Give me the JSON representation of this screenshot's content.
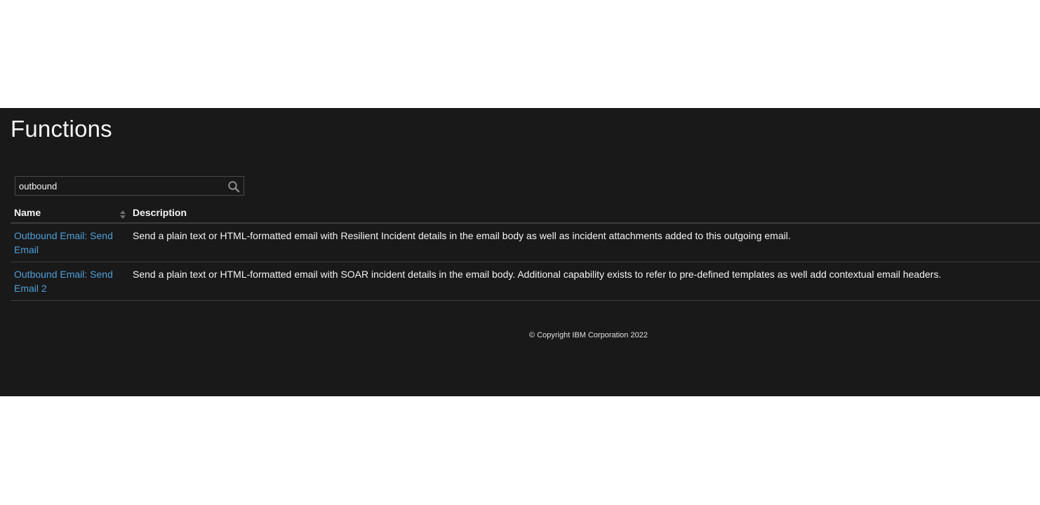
{
  "page": {
    "title": "Functions"
  },
  "search": {
    "value": "outbound",
    "icon": "search-icon"
  },
  "table": {
    "headers": {
      "name": "Name",
      "description": "Description"
    },
    "rows": [
      {
        "name": "Outbound Email: Send Email",
        "description": "Send a plain text or HTML-formatted email with Resilient Incident details in the email body as well as incident attachments added to this outgoing email."
      },
      {
        "name": "Outbound Email: Send Email 2",
        "description": "Send a plain text or HTML-formatted email with SOAR incident details in the email body. Additional capability exists to refer to pre-defined templates as well add contextual email headers."
      }
    ]
  },
  "footer": {
    "copyright": "© Copyright IBM Corporation 2022"
  },
  "colors": {
    "background": "#191919",
    "text": "#f4f4f4",
    "link": "#4e9fd8",
    "divider": "#3d3d3d"
  }
}
